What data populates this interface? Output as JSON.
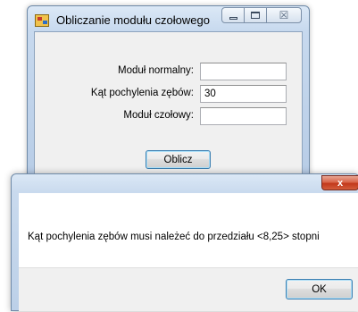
{
  "main_window": {
    "title": "Obliczanie modułu czołowego",
    "app_icon": "form-app-icon",
    "controls": {
      "minimize_icon": "minimize-icon",
      "maximize_icon": "maximize-icon",
      "close_glyph": "☒"
    },
    "fields": [
      {
        "label": "Moduł normalny:",
        "value": ""
      },
      {
        "label": "Kąt pochylenia zębów:",
        "value": "30"
      },
      {
        "label": "Moduł czołowy:",
        "value": ""
      }
    ],
    "compute_button": "Oblicz"
  },
  "message_box": {
    "close_glyph": "x",
    "text": "Kąt pochylenia zębów musi należeć do przedziału <8,25> stopni",
    "ok_button": "OK"
  }
}
